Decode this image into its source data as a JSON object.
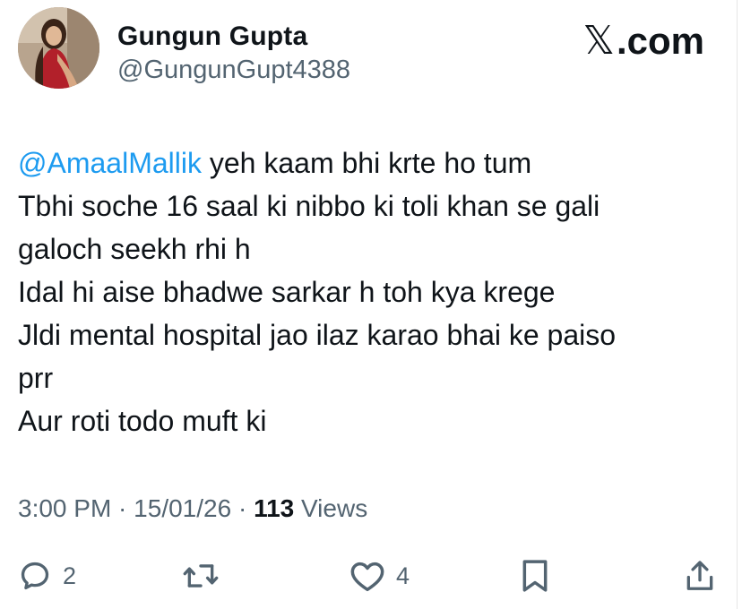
{
  "brand": {
    "label": ".com"
  },
  "author": {
    "display_name": "Gungun Gupta",
    "handle": "@GungunGupt4388"
  },
  "tweet": {
    "mention": "@AmaalMallik",
    "first_line_rest": " yeh kaam bhi krte ho tum",
    "lines": [
      "Tbhi soche 16 saal ki nibbo ki toli khan se gali",
      "galoch seekh rhi h",
      "Idal hi aise bhadwe sarkar h toh kya krege",
      "Jldi mental hospital jao ilaz karao bhai ke paiso",
      "prr",
      "Aur roti todo muft ki"
    ]
  },
  "meta": {
    "time": "3:00 PM",
    "separator": " · ",
    "date": "15/01/26",
    "views_count": "113",
    "views_label": " Views"
  },
  "actions": {
    "replies": "2",
    "likes": "4",
    "icons": [
      "reply-icon",
      "retweet-icon",
      "like-icon",
      "bookmark-icon",
      "share-icon"
    ]
  },
  "colors": {
    "text": "#0f1419",
    "secondary": "#536471",
    "link": "#1d9bf0"
  }
}
